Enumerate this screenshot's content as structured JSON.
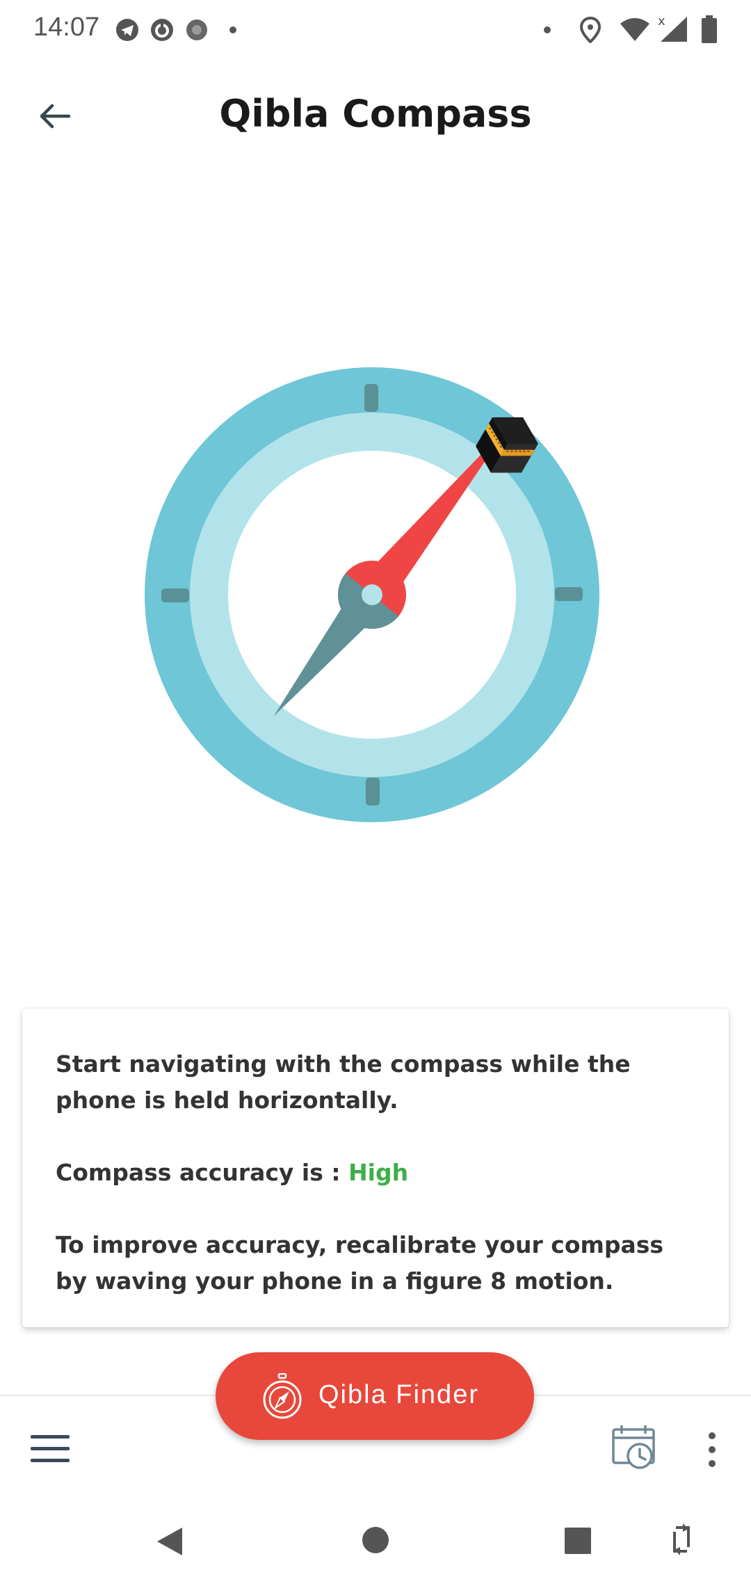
{
  "status_bar": {
    "time": "14:07",
    "left_icons": [
      "telegram-icon",
      "sync-icon",
      "settings-icon",
      "dot-icon"
    ],
    "right_icons": [
      "dot-icon",
      "location-icon",
      "wifi-icon",
      "signal-icon",
      "battery-icon"
    ]
  },
  "header": {
    "title": "Qibla Compass",
    "back_icon": "arrow-left-icon"
  },
  "compass": {
    "icon": "kaaba-icon",
    "colors": {
      "outer_ring": "#6ec6d6",
      "inner_ring": "#b3e3ea",
      "needle_north": "#f04545",
      "needle_south": "#5f9197"
    }
  },
  "info_card": {
    "line1": "Start navigating with the compass while the phone is held horizontally.",
    "accuracy_label": "Compass accuracy is : ",
    "accuracy_value": "High",
    "accuracy_color": "#3fae49",
    "line3": "To improve accuracy, recalibrate your compass by waving your phone in a figure 8 motion."
  },
  "bottom_bar": {
    "menu_icon": "hamburger-menu-icon",
    "calendar_icon": "calendar-clock-icon",
    "more_icon": "more-vertical-icon"
  },
  "fab": {
    "label": "Qibla Finder",
    "icon": "compass-icon",
    "color": "#e8483b"
  },
  "nav_bar": {
    "icons": [
      "back-triangle-icon",
      "home-circle-icon",
      "recents-square-icon",
      "rotate-icon"
    ]
  }
}
